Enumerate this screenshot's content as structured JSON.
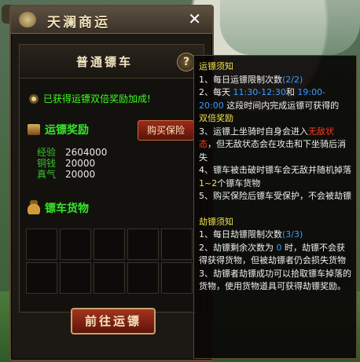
{
  "window": {
    "title": "天澜商运",
    "close_label": "✕",
    "panel_title": "普通镖车",
    "help_label": "?",
    "notice": "已获得运镖双倍奖励加成!",
    "reward_section": "运镖奖励",
    "buy_insurance": "购买保险",
    "rewards": [
      {
        "label": "经验",
        "value": "2604000"
      },
      {
        "label": "铜钱",
        "value": "20000"
      },
      {
        "label": "真气",
        "value": "20000"
      }
    ],
    "cargo_section": "镖车货物",
    "go_button": "前往运镖"
  },
  "tooltip": {
    "escort_header": "运镖须知",
    "e1_pre": "1、每日运镖限制次数",
    "e1_val": "(2/2)",
    "e2_pre": "2、每天",
    "e2_t1": "11:30-12:30",
    "e2_and": "和",
    "e2_t2_a": "19:00-",
    "e2_t2_b": "20:00",
    "e2_post": "这段时间内完成运镖可获得的",
    "e2_bonus": "双倍奖励",
    "e3_pre": "3、运镖上坐骑时自身会进入",
    "e3_red_a": "无敌状",
    "e3_red_b": "态",
    "e3_post": "，但无敌状态会在攻击和下坐骑后消失",
    "e4_pre": "4、镖车被击破时镖车会无敌并随机掉落",
    "e4_range": "1~2",
    "e4_post": "个镖车货物",
    "e5": "5、购买保险后镖车受保护，不会被劫镖",
    "rob_header": "劫镖须知",
    "r1_pre": "1、每日劫镖限制次数",
    "r1_val": "(3/3)",
    "r2_pre": "2、劫镖剩余次数为",
    "r2_val": "0",
    "r2_post": "时，劫镖不会获得获得货物，但被劫镖者仍会损失货物",
    "r3": "3、劫镖者劫镖成功可以拾取镖车掉落的货物，使用货物道具可获得劫镖奖励。"
  },
  "colors": {
    "green": "#35e82a",
    "yellow": "#f2e34b",
    "blue": "#3a9cff",
    "red": "#ff3a1e"
  }
}
